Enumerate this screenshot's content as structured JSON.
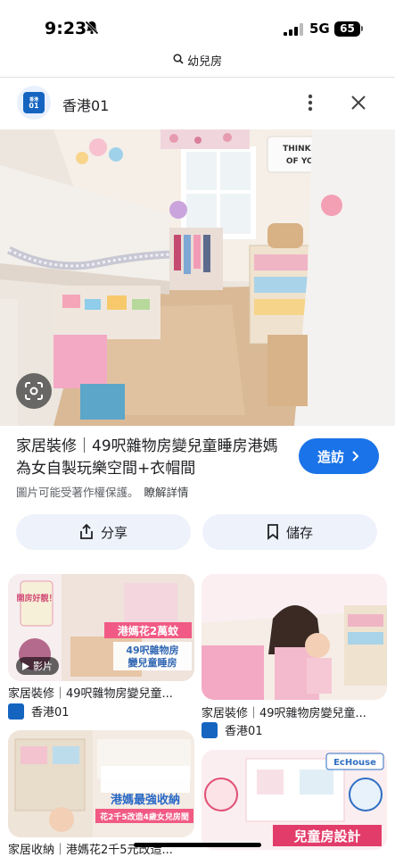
{
  "status": {
    "time": "9:23",
    "network": "5G",
    "battery": "65"
  },
  "search": {
    "query": "幼兒房"
  },
  "source": {
    "name": "香港01",
    "logo_text": "香港01"
  },
  "result": {
    "title": "家居裝修｜49呎雜物房變兒童睡房港媽為女自製玩樂空間+衣帽間",
    "visit_label": "造訪",
    "copyright_note": "圖片可能受著作權保護。",
    "learn_more": "瞭解詳情"
  },
  "actions": {
    "share_label": "分享",
    "save_label": "儲存"
  },
  "hero_sign": {
    "line1": "THINKING",
    "line2": "OF YOU!"
  },
  "grid": [
    {
      "title": "家居裝修｜49呎雜物房變兒童...",
      "source": "香港01",
      "badge": "影片",
      "overlay_1": "港媽花2萬蚊",
      "overlay_2": "49呎雜物房",
      "overlay_3": "變兒童睡房",
      "tag": "開房好靚！"
    },
    {
      "title": "家居裝修｜49呎雜物房變兒童...",
      "source": "香港01"
    },
    {
      "title": "家居收納｜港媽花2千5元改造...",
      "overlay_1": "港媽最強收納",
      "overlay_2": "花2千5改造4歲女兒房間"
    },
    {
      "overlay_1": "兒童房設計",
      "brand": "EcHouse"
    }
  ],
  "colors": {
    "accent": "#1a73e8",
    "button_bg": "#eef2fb"
  }
}
